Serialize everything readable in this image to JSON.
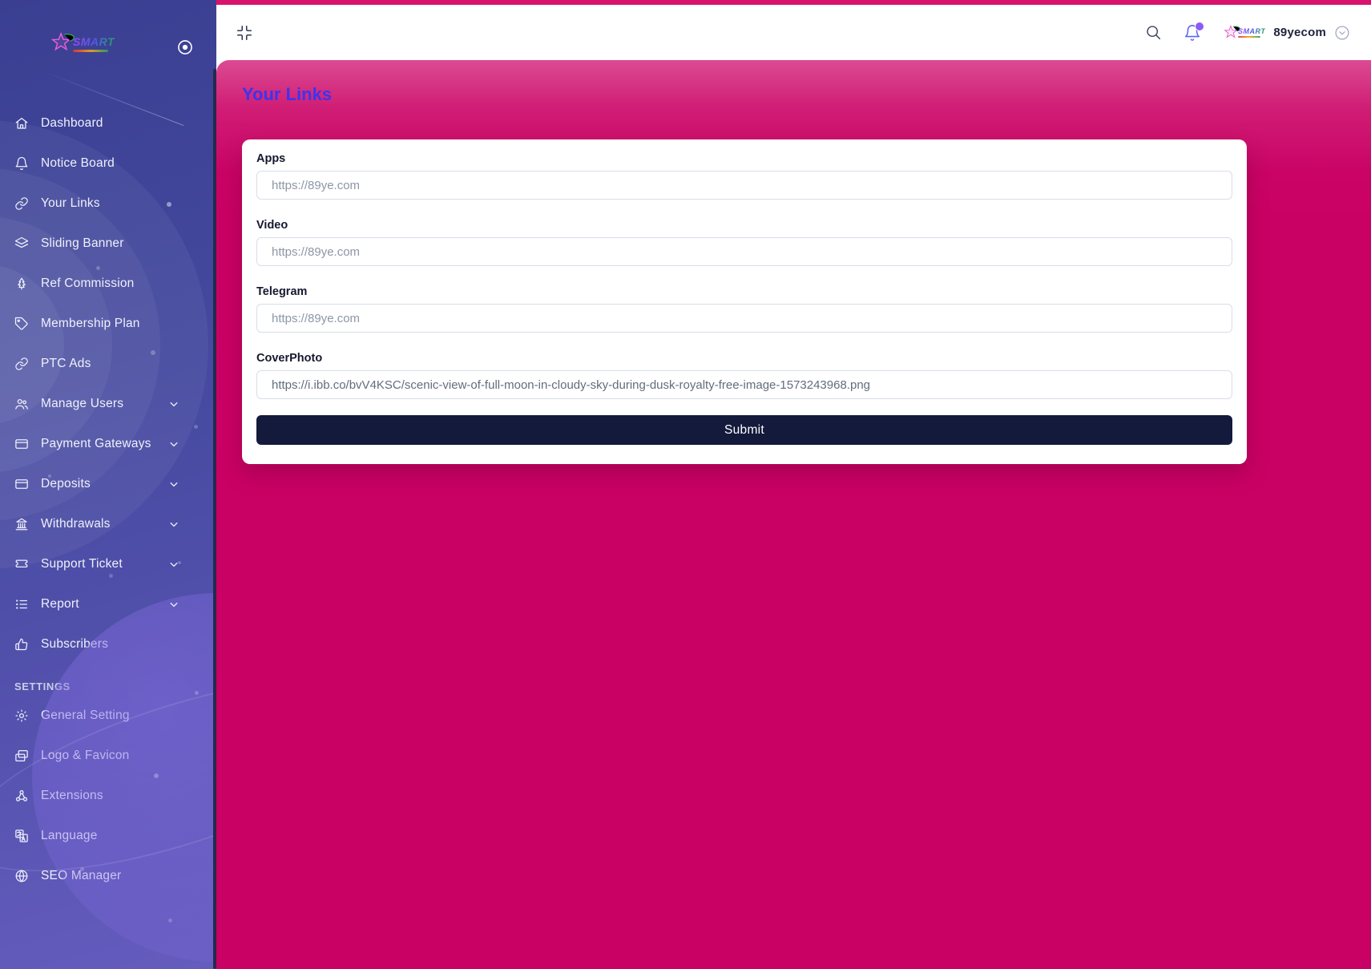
{
  "brand": {
    "logo_text": "SMART",
    "logo_icon": "star-icon"
  },
  "topbar": {
    "collapse_icon": "compress-icon",
    "search_icon": "search-icon",
    "bell_icon": "bell-icon",
    "bell_badge": true,
    "username": "89yecom",
    "menu_icon": "chevron-down-circle-icon"
  },
  "sidebar": {
    "toggle_icon": "record-circle-icon",
    "items": [
      {
        "label": "Dashboard",
        "icon": "home-icon",
        "expandable": false
      },
      {
        "label": "Notice Board",
        "icon": "bell-icon",
        "expandable": false
      },
      {
        "label": "Your Links",
        "icon": "link-icon",
        "expandable": false
      },
      {
        "label": "Sliding Banner",
        "icon": "layers-icon",
        "expandable": false
      },
      {
        "label": "Ref Commission",
        "icon": "tree-icon",
        "expandable": false
      },
      {
        "label": "Membership Plan",
        "icon": "tag-icon",
        "expandable": false
      },
      {
        "label": "PTC Ads",
        "icon": "link-icon",
        "expandable": false
      },
      {
        "label": "Manage Users",
        "icon": "users-icon",
        "expandable": true
      },
      {
        "label": "Payment Gateways",
        "icon": "credit-card-icon",
        "expandable": true
      },
      {
        "label": "Deposits",
        "icon": "credit-card-icon",
        "expandable": true
      },
      {
        "label": "Withdrawals",
        "icon": "bank-icon",
        "expandable": true
      },
      {
        "label": "Support Ticket",
        "icon": "ticket-icon",
        "expandable": true
      },
      {
        "label": "Report",
        "icon": "list-icon",
        "expandable": true
      },
      {
        "label": "Subscribers",
        "icon": "thumbs-up-icon",
        "expandable": false
      }
    ],
    "settings_header": "SETTINGS",
    "settings_items": [
      {
        "label": "General Setting",
        "icon": "gear-icon"
      },
      {
        "label": "Logo & Favicon",
        "icon": "images-icon"
      },
      {
        "label": "Extensions",
        "icon": "nodes-icon"
      },
      {
        "label": "Language",
        "icon": "translate-icon"
      },
      {
        "label": "SEO Manager",
        "icon": "globe-icon"
      }
    ]
  },
  "page": {
    "title": "Your Links"
  },
  "form": {
    "fields": [
      {
        "label": "Apps",
        "placeholder": "https://89ye.com",
        "value": ""
      },
      {
        "label": "Video",
        "placeholder": "https://89ye.com",
        "value": ""
      },
      {
        "label": "Telegram",
        "placeholder": "https://89ye.com",
        "value": ""
      },
      {
        "label": "CoverPhoto",
        "placeholder": "",
        "value": "https://i.ibb.co/bvV4KSC/scenic-view-of-full-moon-in-cloudy-sky-during-dusk-royalty-free-image-1573243968.png"
      }
    ],
    "submit_label": "Submit"
  },
  "colors": {
    "content_pink": "#ca0164",
    "top_strip_pink": "#d7136e",
    "sidebar_gradient_top": "#3a3f92",
    "sidebar_gradient_bottom": "#655cbe",
    "title_blue": "#3c34ee",
    "submit_navy": "#141a3c",
    "bell_indigo": "#5a67f2",
    "badge_violet": "#8a5cf5"
  }
}
